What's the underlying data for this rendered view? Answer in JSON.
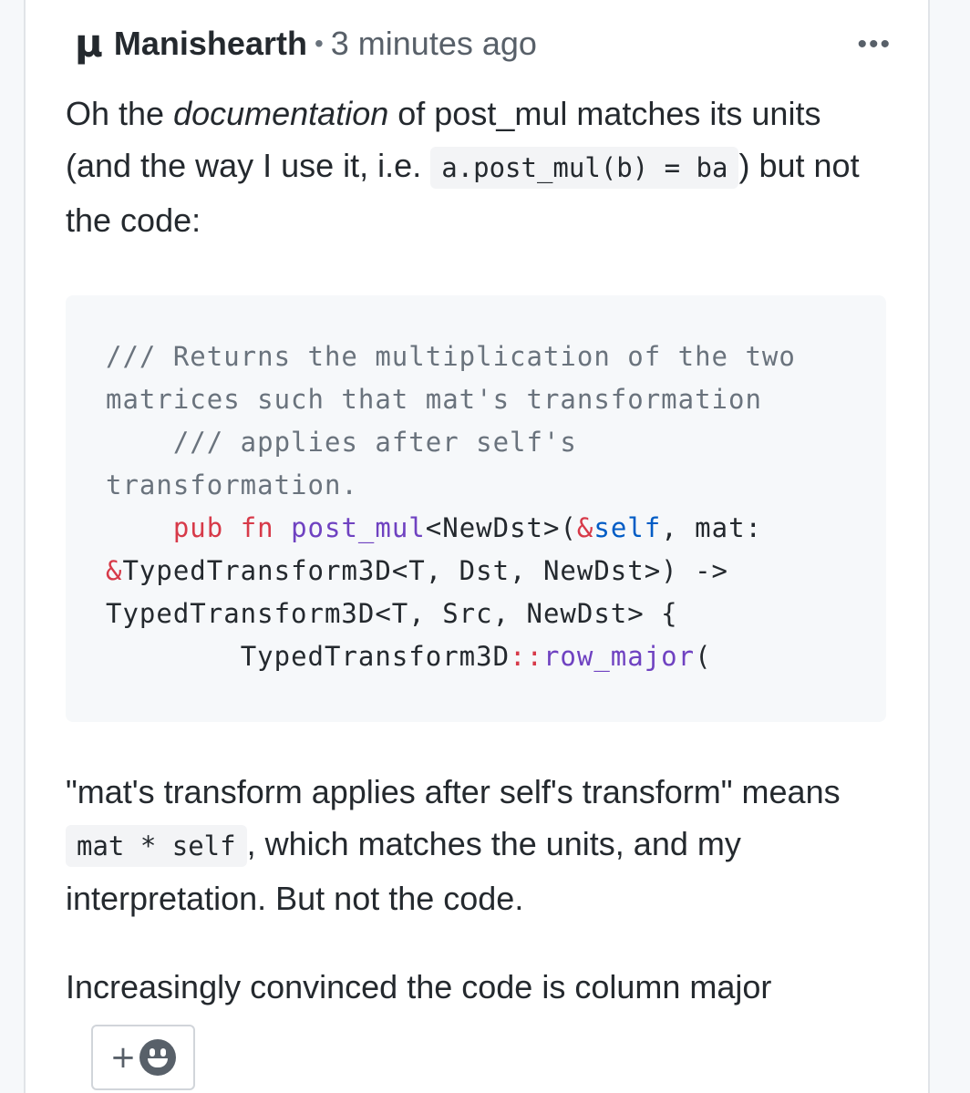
{
  "comment": {
    "avatar_glyph": "µ",
    "author": "Manishearth",
    "separator": "•",
    "timestamp": "3 minutes ago",
    "more_label": "•••",
    "para1": {
      "t1": "Oh the ",
      "em": "documentation",
      "t2": " of post_mul matches its units (and the way I use it, i.e. ",
      "code": "a.post_mul(b) = ba",
      "t3": ") but not the code:"
    },
    "code_block": {
      "line1": "/// Returns the multiplication of the two matrices such that mat's transformation",
      "line2_indent": "    ",
      "line2": "/// applies after self's transformation.",
      "line3_indent": "    ",
      "kw_pub": "pub",
      "kw_fn": "fn",
      "fn_name": "post_mul",
      "generic": "<NewDst>(",
      "amp_self": "&self",
      "sig_rest1": ", mat: ",
      "amp": "&",
      "sig_rest2": "TypedTransform3D<T, Dst, NewDst>) -> TypedTransform3D<T, Src, NewDst> {",
      "line4_indent": "        ",
      "type_name": "TypedTransform3D",
      "path_sep": "::",
      "method": "row_major",
      "paren": "("
    },
    "para2": {
      "t1": "\"mat's transform applies after self's transform\" means ",
      "code": "mat * self",
      "t2": ", which matches the units, and my interpretation. But not the code."
    },
    "para3": "Increasingly convinced the code is column major",
    "reaction": {
      "plus": "+",
      "icon": "smiley-icon"
    }
  }
}
